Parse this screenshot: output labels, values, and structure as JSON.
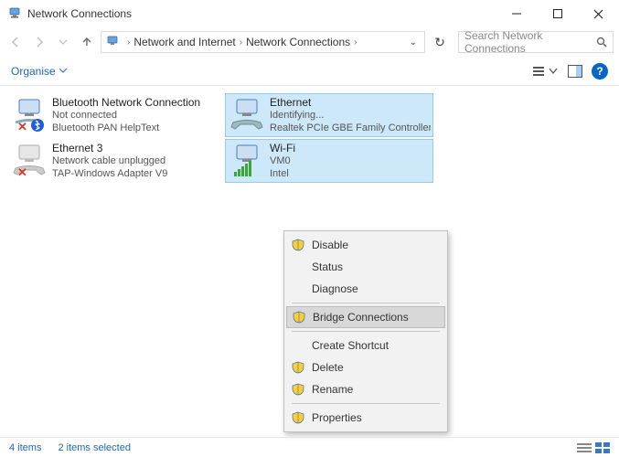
{
  "window": {
    "title": "Network Connections"
  },
  "breadcrumb": {
    "p1": "Network and Internet",
    "p2": "Network Connections"
  },
  "search": {
    "placeholder": "Search Network Connections"
  },
  "toolbar": {
    "organise": "Organise"
  },
  "connections": [
    {
      "name": "Bluetooth Network Connection",
      "status": "Not connected",
      "device": "Bluetooth PAN HelpText"
    },
    {
      "name": "Ethernet",
      "status": "Identifying...",
      "device": "Realtek PCIe GBE Family Controller"
    },
    {
      "name": "Ethernet 3",
      "status": "Network cable unplugged",
      "device": "TAP-Windows Adapter V9"
    },
    {
      "name": "Wi-Fi",
      "status": "VM0",
      "device": "Intel"
    }
  ],
  "context_menu": {
    "disable": "Disable",
    "status": "Status",
    "diagnose": "Diagnose",
    "bridge": "Bridge Connections",
    "shortcut": "Create Shortcut",
    "delete": "Delete",
    "rename": "Rename",
    "properties": "Properties"
  },
  "statusbar": {
    "items": "4 items",
    "selected": "2 items selected"
  }
}
